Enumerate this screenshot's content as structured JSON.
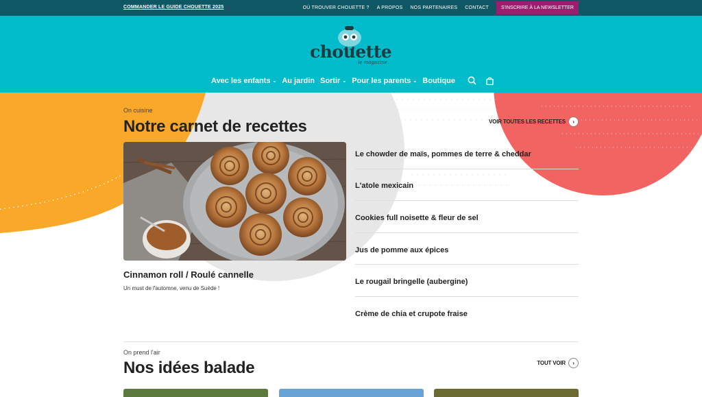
{
  "topbar": {
    "promo": "COMMANDER LE GUIDE CHOUETTE 2025",
    "links": [
      "OÙ TROUVER CHOUETTE ?",
      "A PROPOS",
      "NOS PARTENAIRES",
      "CONTACT"
    ],
    "newsletter": "S'INSCRIRE À LA NEWSLETTER"
  },
  "header": {
    "logo_word": "chouette",
    "logo_sub": "le magazine",
    "nav": [
      {
        "label": "Avec les enfants",
        "dropdown": true
      },
      {
        "label": "Au jardin",
        "dropdown": false
      },
      {
        "label": "Sortir",
        "dropdown": true
      },
      {
        "label": "Pour les parents",
        "dropdown": true
      },
      {
        "label": "Boutique",
        "dropdown": false
      }
    ],
    "icons": [
      "search-icon",
      "shopping-bag-icon"
    ]
  },
  "recipes": {
    "kicker": "On cuisine",
    "title": "Notre carnet de recettes",
    "see_all": "VOIR TOUTES LES RECETTES",
    "feature": {
      "title": "Cinnamon roll / Roulé cannelle",
      "description": "Un must de l'automne, venu de Suède !"
    },
    "list": [
      "Le chowder de maïs, pommes de terre & cheddar",
      "L'atole mexicain",
      "Cookies full noisette & fleur de sel",
      "Jus de pomme aux épices",
      "Le rougail bringelle (aubergine)",
      "Crème de chia et crupote fraise"
    ]
  },
  "walks": {
    "kicker": "On prend l'air",
    "title": "Nos idées balade",
    "see_all": "TOUT VOIR"
  },
  "colors": {
    "topbar": "#0e5866",
    "header": "#00bccb",
    "newsletter": "#9b1f6e",
    "orange_shape": "#f9a82a",
    "coral_shape": "#f26461",
    "grey_shape": "#e7e7e7"
  }
}
